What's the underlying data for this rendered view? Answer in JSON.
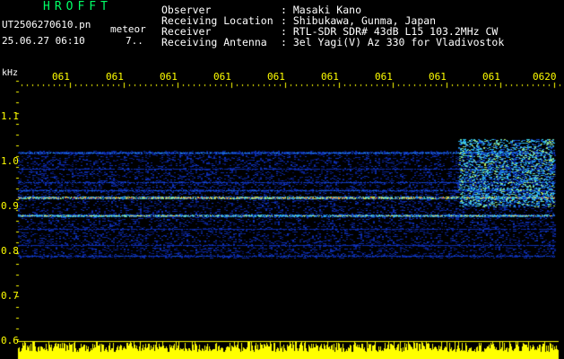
{
  "header": {
    "app_title": "HROFFT",
    "file_name": "UT2506270610.pn",
    "meteor_label": "meteor",
    "timestamp": "25.06.27 06:10",
    "count": "7..",
    "info": [
      {
        "label": "Observer",
        "value": ": Masaki Kano"
      },
      {
        "label": "Receiving Location",
        "value": ": Shibukawa, Gunma, Japan"
      },
      {
        "label": "Receiver",
        "value": ": RTL-SDR SDR# 43dB L15 103.2MHz CW"
      },
      {
        "label": "Receiving Antenna",
        "value": ": 3el Yagi(V) Az 330 for Vladivostok"
      }
    ]
  },
  "colors": {
    "background": "#000000",
    "axis_labels": "#ffff00",
    "title": "#00ff66",
    "signal_low": "#0a1a8c",
    "signal_high": "#ff3300",
    "echo_trace": "#ffff00"
  },
  "chart_data": {
    "type": "heatmap",
    "y_unit": "kHz",
    "y_ticks": [
      "1.1",
      "1.0",
      "0.9",
      "0.8",
      "0.7",
      "0.6"
    ],
    "x_ticks": [
      "061",
      "061",
      "061",
      "061",
      "061",
      "061",
      "061",
      "061",
      "061",
      "0620"
    ],
    "ylim": [
      0.6,
      1.15
    ],
    "bands_khz": [
      {
        "center": 1.02,
        "intensity": 0.55
      },
      {
        "center": 0.985,
        "intensity": 0.35
      },
      {
        "center": 0.955,
        "intensity": 0.4
      },
      {
        "center": 0.935,
        "intensity": 0.45
      },
      {
        "center": 0.92,
        "intensity": 1.0
      },
      {
        "center": 0.88,
        "intensity": 0.85
      },
      {
        "center": 0.85,
        "intensity": 0.3
      },
      {
        "center": 0.815,
        "intensity": 0.35
      },
      {
        "center": 0.79,
        "intensity": 0.4
      }
    ],
    "noise_region_khz": [
      0.785,
      1.025
    ],
    "echo_region_start_fraction": 0.82
  }
}
